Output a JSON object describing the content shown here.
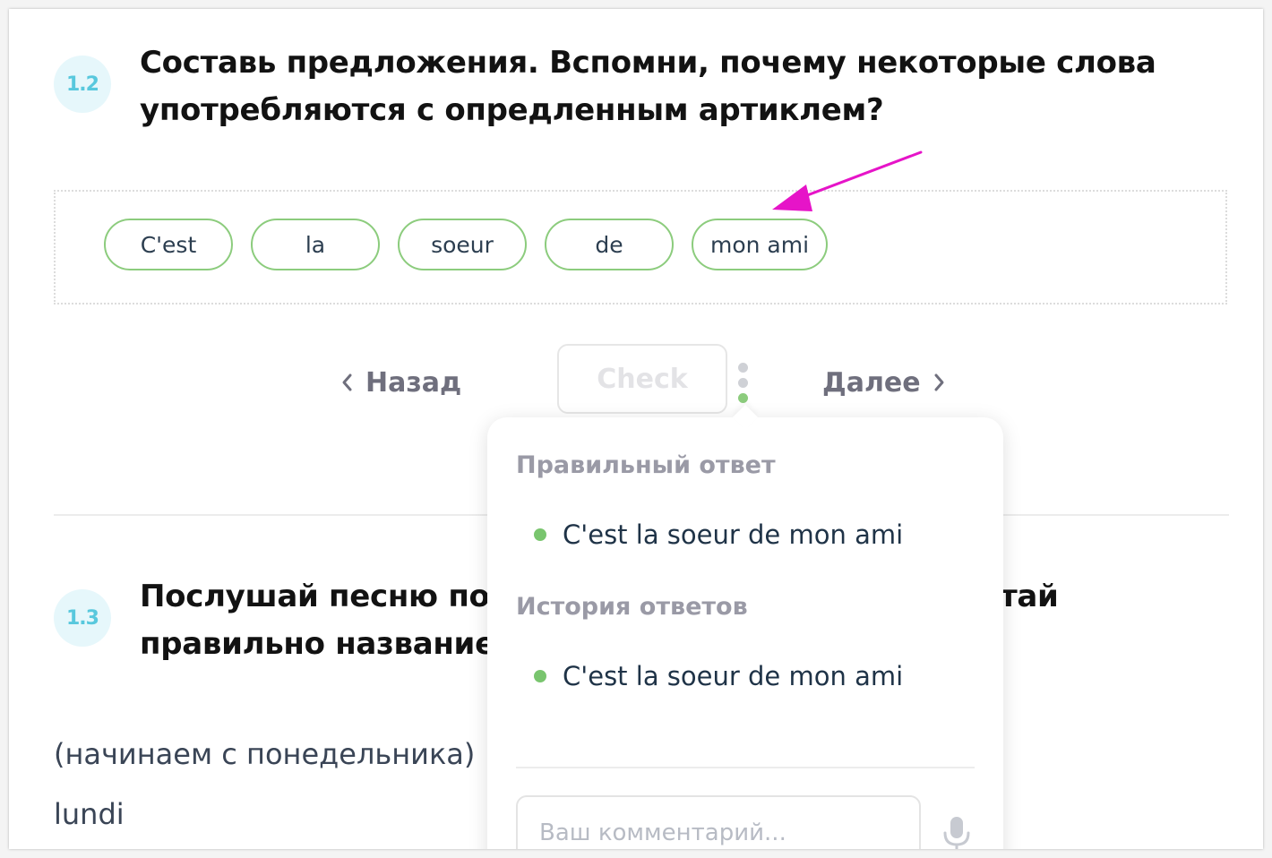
{
  "task_1_2": {
    "number": "1.2",
    "title_line1": "Составь предложения. Вспомни, почему некоторые слова",
    "title_line2": "употребляются с опредленным артиклем?",
    "chips": [
      "C'est",
      "la",
      "soeur",
      "de",
      "mon ami"
    ]
  },
  "controls": {
    "back_label": "Назад",
    "check_label": "Check",
    "next_label": "Далее"
  },
  "task_1_3": {
    "number": "1.3",
    "title_line1_start": "Послушай песню по",
    "title_line1_end": "тай",
    "title_line2": "правильно название",
    "lines": [
      "(начинаем с понедельника)",
      "lundi"
    ]
  },
  "popover": {
    "correct_heading": "Правильный ответ",
    "correct_answer": "C'est la soeur de mon ami",
    "history_heading": "История ответов",
    "history_answer": "C'est la soeur de mon ami",
    "comment_placeholder": "Ваш комментарий..."
  },
  "colors": {
    "accent_green": "#8ccc7d",
    "badge_blue": "#58c8dd",
    "arrow_magenta": "#e614c8"
  },
  "icons": {
    "back": "chevron-left-icon",
    "next": "chevron-right-icon",
    "menu": "vertical-dots-icon",
    "mic": "microphone-icon"
  }
}
